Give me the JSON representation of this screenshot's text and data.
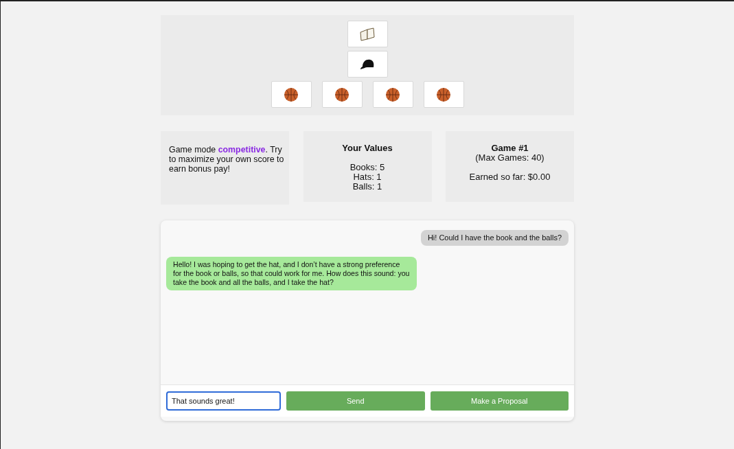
{
  "item_rows": [
    [
      {
        "kind": "book"
      }
    ],
    [
      {
        "kind": "hat"
      }
    ],
    [
      {
        "kind": "ball"
      },
      {
        "kind": "ball"
      },
      {
        "kind": "ball"
      },
      {
        "kind": "ball"
      }
    ]
  ],
  "mode_text": "Game mode **competitive**. Try to maximize your own score to earn bonus pay!",
  "values": {
    "title": "Your Values",
    "lines": [
      "Books: 5",
      "Hats: 1",
      "Balls: 1"
    ]
  },
  "game": {
    "title": "Game #1",
    "max": "(Max Games: 40)",
    "earned": "Earned so far: $0.00"
  },
  "messages": [
    {
      "mine": true,
      "text": "Hi! Could I have the book and the balls?"
    },
    {
      "mine": false,
      "text": "Hello! I was hoping to get the hat, and I don’t have a strong preference for the book or balls, so that could work for me. How does this sound: you take the book and all the balls, and I take the hat?"
    }
  ],
  "input": {
    "value": "That sounds great!",
    "focused": true
  },
  "buttons": [
    "Send",
    "Make a Proposal"
  ]
}
